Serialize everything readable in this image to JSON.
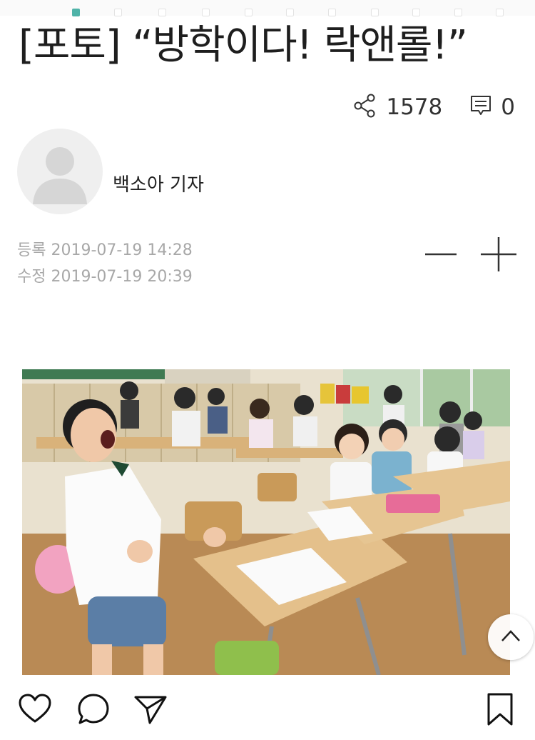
{
  "article": {
    "title": "[포토] “방학이다! 락앤롤!”",
    "share_count": "1578",
    "comment_count": "0",
    "author": "백소아 기자",
    "registered": "등록 2019-07-19 14:28",
    "modified": "수정 2019-07-19 20:39"
  },
  "icons": {
    "share": "share-icon",
    "comment": "comment-icon",
    "font_decrease": "minus-icon",
    "font_increase": "plus-icon",
    "scroll_top": "chevron-up-icon",
    "like": "heart-icon",
    "reply": "speech-bubble-icon",
    "send": "paper-plane-icon",
    "bookmark": "bookmark-icon"
  },
  "colors": {
    "accent": "#4fb3a8",
    "meta_text": "#a8a8a8",
    "title_text": "#1e1e1e"
  }
}
